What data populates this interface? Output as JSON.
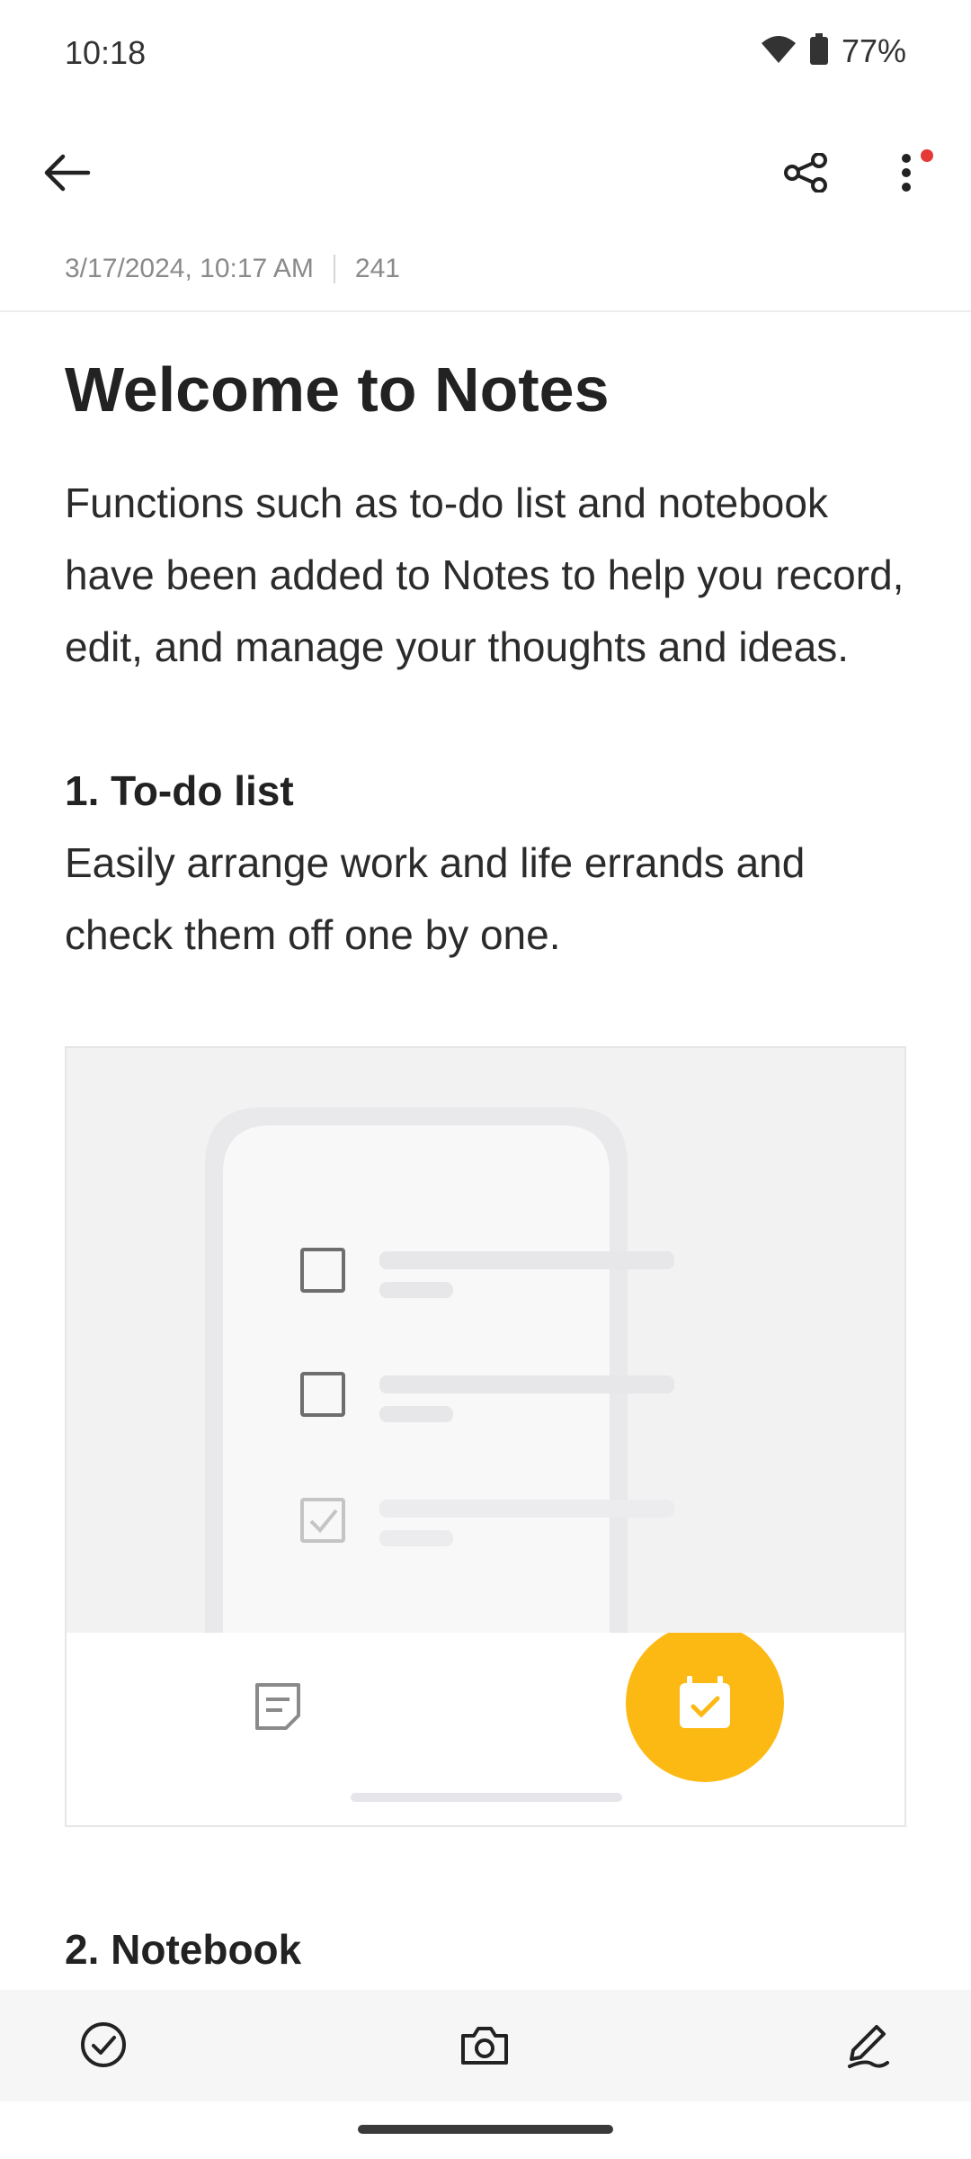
{
  "status": {
    "time": "10:18",
    "battery": "77%"
  },
  "toolbar": {
    "back_icon": "arrow-left-icon",
    "share_icon": "share-icon",
    "more_icon": "more-vertical-icon"
  },
  "note": {
    "date": "3/17/2024, 10:17 AM",
    "word_count": "241",
    "title": "Welcome to Notes",
    "intro": "Functions such as to-do list and notebook have been added to Notes to help you record, edit, and manage your thoughts and ideas.",
    "section1_heading": "1. To-do list",
    "section1_text": "Easily arrange work and life errands and check them off one by one.",
    "section2_heading": "2. Notebook"
  },
  "bottom_bar": {
    "checklist_icon": "check-circle-icon",
    "camera_icon": "camera-icon",
    "handwriting_icon": "pen-icon"
  },
  "colors": {
    "accent": "#FDB913",
    "badge": "#E53935"
  }
}
